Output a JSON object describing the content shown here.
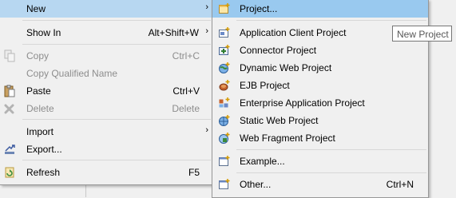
{
  "context_menu": {
    "items": [
      {
        "label": "New",
        "accel": "",
        "icon": "",
        "submenu": true
      },
      {
        "label": "Show In",
        "accel": "Alt+Shift+W",
        "icon": "",
        "submenu": true
      },
      {
        "label": "Copy",
        "accel": "Ctrl+C",
        "icon": "copy-icon",
        "disabled": true
      },
      {
        "label": "Copy Qualified Name",
        "accel": "",
        "icon": "",
        "disabled": true
      },
      {
        "label": "Paste",
        "accel": "Ctrl+V",
        "icon": "paste-icon"
      },
      {
        "label": "Delete",
        "accel": "Delete",
        "icon": "delete-icon",
        "disabled": true
      },
      {
        "label": "Import",
        "accel": "",
        "icon": "",
        "submenu": true
      },
      {
        "label": "Export...",
        "accel": "",
        "icon": "export-icon"
      },
      {
        "label": "Refresh",
        "accel": "F5",
        "icon": "refresh-icon"
      }
    ],
    "submenu_arrow": "›"
  },
  "new_submenu": {
    "items": [
      {
        "label": "Project...",
        "accel": "",
        "icon": "project-icon"
      },
      {
        "label": "Application Client Project",
        "icon": "app-client-project-icon"
      },
      {
        "label": "Connector Project",
        "icon": "connector-project-icon"
      },
      {
        "label": "Dynamic Web Project",
        "icon": "dynamic-web-project-icon"
      },
      {
        "label": "EJB Project",
        "icon": "ejb-project-icon"
      },
      {
        "label": "Enterprise Application Project",
        "icon": "enterprise-app-project-icon"
      },
      {
        "label": "Static Web Project",
        "icon": "static-web-project-icon"
      },
      {
        "label": "Web Fragment Project",
        "icon": "web-fragment-project-icon"
      },
      {
        "label": "Example...",
        "icon": "example-icon"
      },
      {
        "label": "Other...",
        "accel": "Ctrl+N",
        "icon": "other-icon"
      }
    ]
  },
  "tooltip": {
    "text": "New Project"
  },
  "colors": {
    "highlight": "#99c9ef",
    "menu_bg": "#f0f0f0",
    "disabled_text": "#8d8d8d"
  }
}
